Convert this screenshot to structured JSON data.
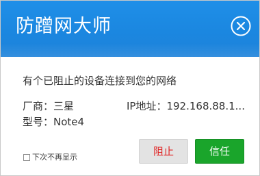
{
  "dialog": {
    "title": "防蹭网大师",
    "message": "有个已阻止的设备连接到您的网络",
    "vendor_label": "厂商：三星",
    "model_label": "型号：Note4",
    "ip_label": "IP地址：192.168.88.1...",
    "checkbox_label": "下次不再显示",
    "block_button": "阻止",
    "trust_button": "信任",
    "close_icon": "close-icon"
  },
  "colors": {
    "titlebar": "#1b87e0",
    "block_text": "#e02020",
    "trust_bg": "#1aa52b"
  }
}
